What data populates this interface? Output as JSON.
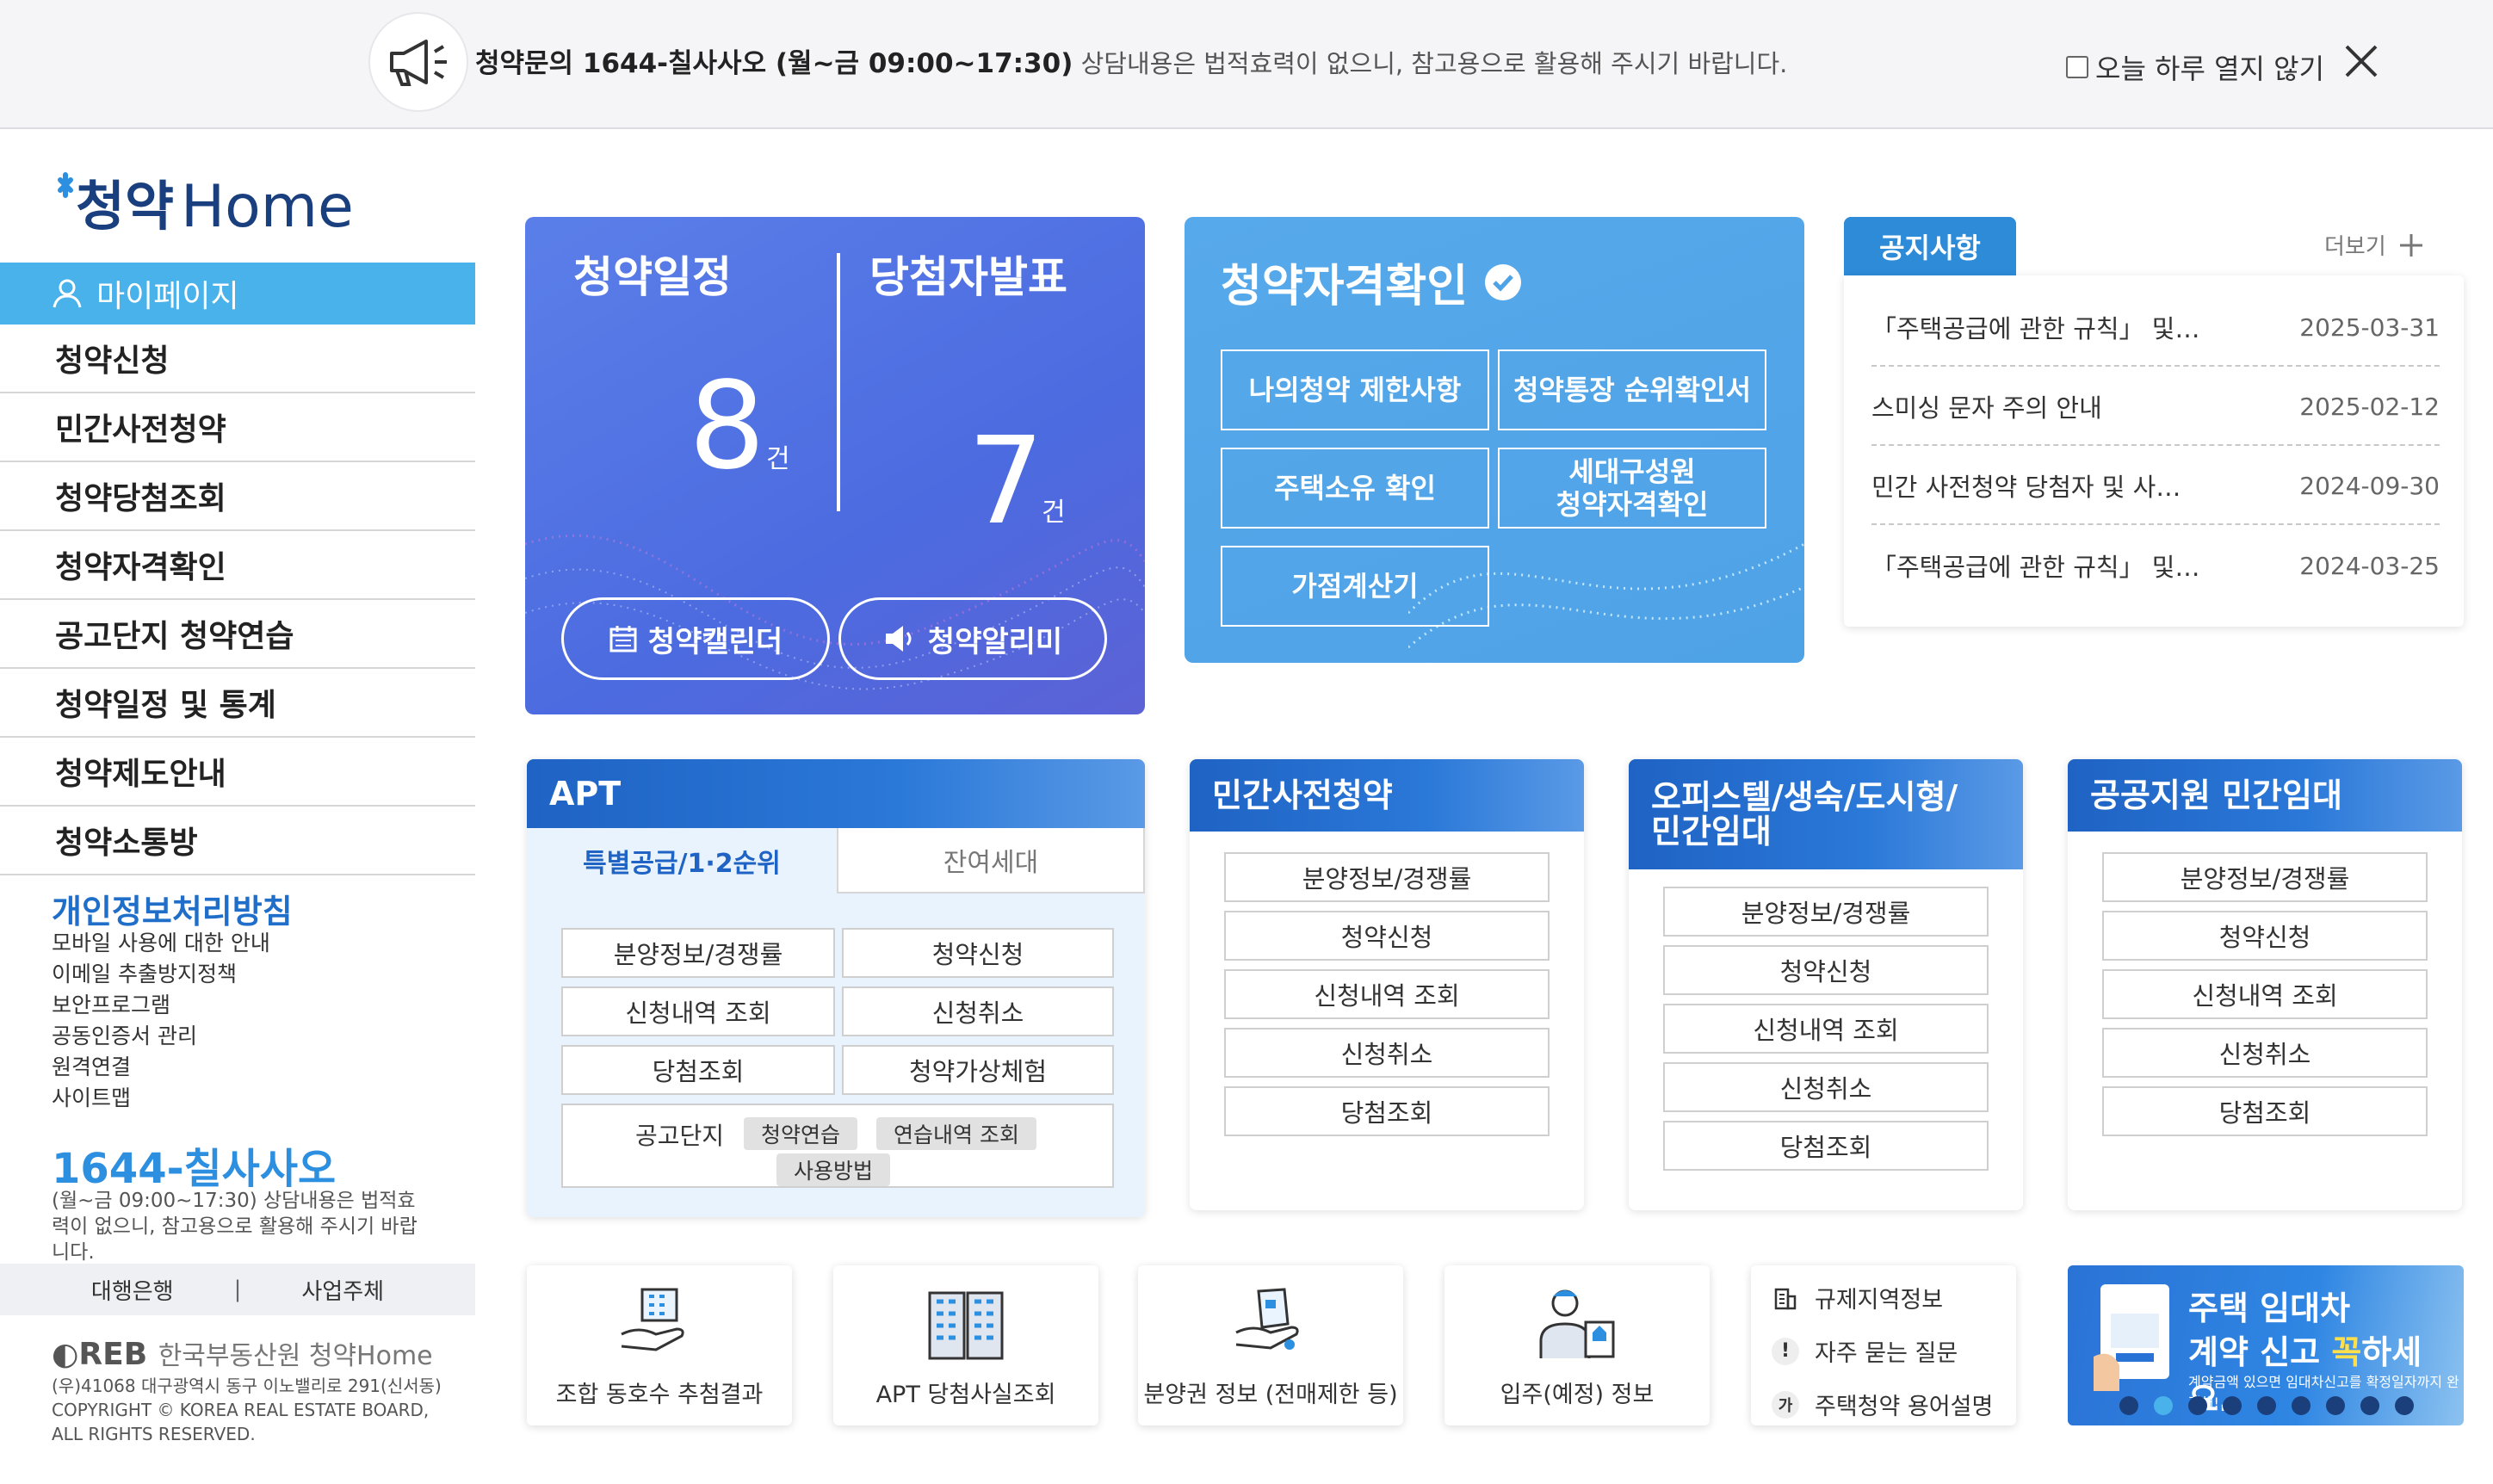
{
  "topbar": {
    "bold_part": "청약문의 1644-칠사사오 (월~금 09:00~17:30)",
    "rest_part": " 상담내용은 법적효력이 없으니, 참고용으로 활용해 주시기 바랍니다.",
    "no_show_label": "오늘 하루 열지 않기"
  },
  "logo": {
    "text_kr": "청약",
    "text_en": "Home"
  },
  "sidebar": {
    "mypage": "마이페이지",
    "items": [
      "청약신청",
      "민간사전청약",
      "청약당첨조회",
      "청약자격확인",
      "공고단지 청약연습",
      "청약일정 및 통계",
      "청약제도안내",
      "청약소통방"
    ],
    "privacy_title": "개인정보처리방침",
    "links": [
      "모바일 사용에 대한 안내",
      "이메일 추출방지정책",
      "보안프로그램",
      "공동인증서 관리",
      "원격연결",
      "사이트맵"
    ],
    "phone": "1644-칠사사오",
    "phone_desc": "(월~금 09:00~17:30) 상담내용은 법적효력이 없으니, 참고용으로 활용해 주시기 바랍니다.",
    "bank": "대행은행",
    "business": "사업주체",
    "reb_name": "한국부동산원 청약Home",
    "address": "(우)41068 대구광역시 동구 이노밸리로 291(신서동)",
    "copyright": "COPYRIGHT © KOREA REAL ESTATE BOARD, ALL RIGHTS RESERVED."
  },
  "schedule": {
    "title1": "청약일정",
    "title2": "당첨자발표",
    "count1": "8",
    "count2": "7",
    "unit": "건",
    "calendar_btn": "청약캘린더",
    "alarm_btn": "청약알리미"
  },
  "qualification": {
    "title": "청약자격확인",
    "buttons": [
      "나의청약 제한사항",
      "청약통장 순위확인서",
      "주택소유 확인",
      "세대구성원\n청약자격확인",
      "가점계산기"
    ]
  },
  "notices": {
    "tab": "공지사항",
    "more": "더보기",
    "rows": [
      {
        "title": "「주택공급에 관한 규칙」 및…",
        "date": "2025-03-31"
      },
      {
        "title": "스미싱 문자 주의 안내",
        "date": "2025-02-12"
      },
      {
        "title": "민간 사전청약 당첨자 및 사…",
        "date": "2024-09-30"
      },
      {
        "title": "「주택공급에 관한 규칙」 및…",
        "date": "2024-03-25"
      }
    ]
  },
  "apt": {
    "title": "APT",
    "tab1": "특별공급/1·2순위",
    "tab2": "잔여세대",
    "buttons": [
      "분양정보/경쟁률",
      "청약신청",
      "신청내역 조회",
      "신청취소",
      "당첨조회",
      "청약가상체험"
    ],
    "complex_label": "공고단지",
    "chips": [
      "청약연습",
      "연습내역 조회",
      "사용방법"
    ]
  },
  "private": {
    "title": "민간사전청약",
    "buttons": [
      "분양정보/경쟁률",
      "청약신청",
      "신청내역 조회",
      "신청취소",
      "당첨조회"
    ]
  },
  "officetel": {
    "title1": "오피스텔/생숙/도시형/",
    "title2": "민간임대",
    "buttons": [
      "분양정보/경쟁률",
      "청약신청",
      "신청내역 조회",
      "신청취소",
      "당첨조회"
    ]
  },
  "public": {
    "title": "공공지원 민간임대",
    "buttons": [
      "분양정보/경쟁률",
      "청약신청",
      "신청내역 조회",
      "신청취소",
      "당첨조회"
    ]
  },
  "quick": {
    "items": [
      "조합 동호수 추첨결과",
      "APT 당첨사실조회",
      "분양권 정보 (전매제한 등)",
      "입주(예정) 정보"
    ],
    "list": [
      "규제지역정보",
      "자주 묻는 질문",
      "주택청약 용어설명"
    ]
  },
  "banner": {
    "line1": "주택 임대차",
    "line2_a": "계약 신고 ",
    "line2_b": "꼭",
    "line2_c": "하세요.",
    "sub": "계약금액 있으면 임대차신고를 확정일자까지 완전해!"
  },
  "colors": {
    "primary": "#1f63c4",
    "sky": "#4ab2ea",
    "schedule": "#4c6be0",
    "qual": "#4ea2e6"
  }
}
